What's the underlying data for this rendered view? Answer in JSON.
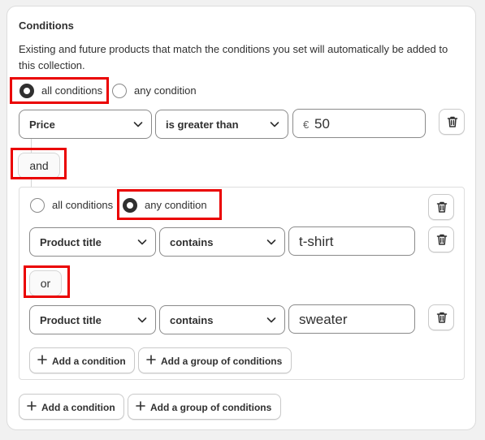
{
  "conditions": {
    "title": "Conditions",
    "description": "Existing and future products that match the conditions you set will automatically be added to this collection.",
    "match": {
      "all_label": "all conditions",
      "any_label": "any condition",
      "selected": "all conditions"
    },
    "rule1": {
      "field": "Price",
      "operator": "is greater than",
      "currency": "€",
      "value": "50"
    },
    "joiner": "and",
    "group": {
      "match": {
        "all_label": "all conditions",
        "any_label": "any condition",
        "selected": "any condition"
      },
      "rules": [
        {
          "field": "Product title",
          "operator": "contains",
          "value": "t-shirt"
        },
        {
          "field": "Product title",
          "operator": "contains",
          "value": "sweater"
        }
      ],
      "joiner": "or",
      "add_condition": "Add a condition",
      "add_group": "Add a group of conditions"
    },
    "add_condition": "Add a condition",
    "add_group": "Add a group of conditions"
  },
  "icons": {
    "trash": "trash-icon",
    "chevron": "chevron-down-icon",
    "plus": "plus-icon"
  },
  "colors": {
    "highlight": "#ea0000",
    "text": "#303030"
  }
}
